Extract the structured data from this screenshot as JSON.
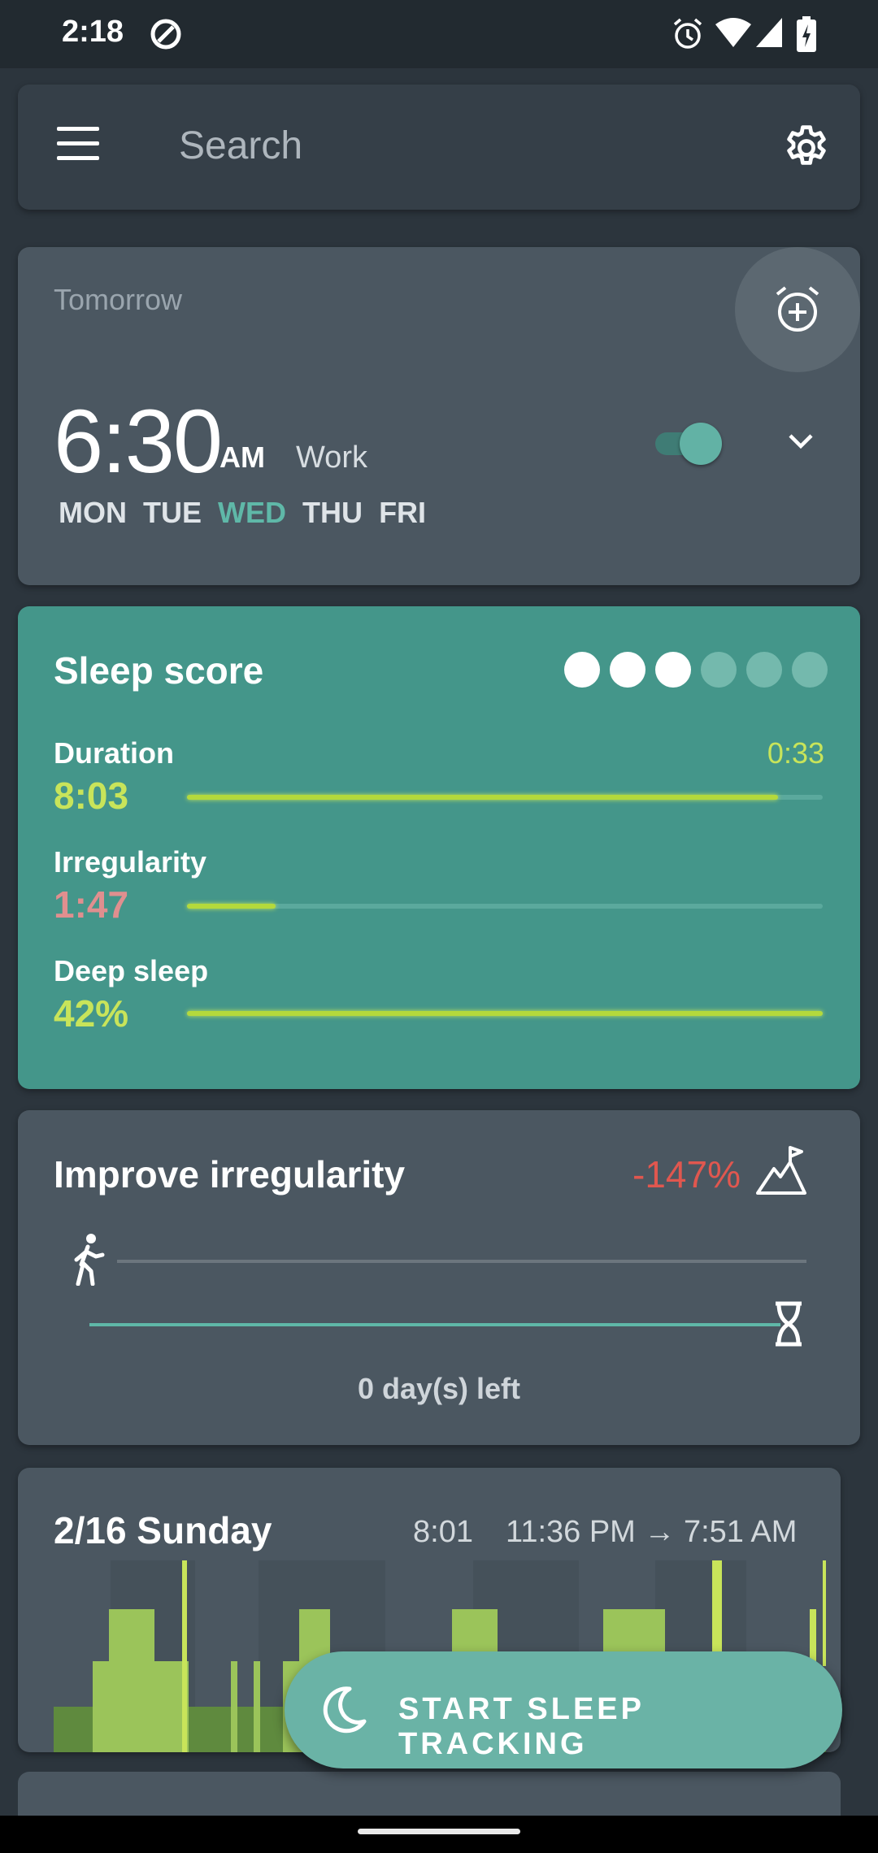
{
  "status_bar": {
    "time": "2:18",
    "icons": [
      "data-saver-icon",
      "alarm-icon",
      "wifi-icon",
      "signal-icon",
      "battery-charging-icon"
    ]
  },
  "search": {
    "placeholder": "Search",
    "menu_icon": "hamburger-menu-icon",
    "settings_icon": "gear-icon"
  },
  "alarm": {
    "label": "Tomorrow",
    "time": "6:30",
    "ampm": "AM",
    "name": "Work",
    "days": [
      {
        "label": "MON",
        "active": false
      },
      {
        "label": "TUE",
        "active": false
      },
      {
        "label": "WED",
        "active": true
      },
      {
        "label": "THU",
        "active": false
      },
      {
        "label": "FRI",
        "active": false
      }
    ],
    "enabled": true,
    "add_icon": "alarm-add-icon",
    "expand_icon": "chevron-down-icon"
  },
  "sleep_score": {
    "title": "Sleep score",
    "dots_total": 6,
    "dots_filled": 3,
    "metrics": [
      {
        "label": "Duration",
        "value": "8:03",
        "value_color": "#c8e45a",
        "progress": 0.93
      },
      {
        "label": "Irregularity",
        "value": "1:47",
        "value_color": "#e08f8f",
        "progress": 0.14
      },
      {
        "label": "Deep sleep",
        "value": "42%",
        "value_color": "#c8e45a",
        "progress": 1.0
      }
    ],
    "delta": "0:33"
  },
  "improve": {
    "title": "Improve irregularity",
    "percent": "-147%",
    "days_left": "0 day(s) left",
    "goal_icon": "mountain-flag-icon",
    "walk_icon": "walking-person-icon",
    "timer_icon": "hourglass-icon"
  },
  "history": {
    "date": "2/16 Sunday",
    "duration": "8:01",
    "range": "11:36 PM → 7:51 AM"
  },
  "fab": {
    "label": "START SLEEP TRACKING",
    "icon": "moon-icon"
  },
  "colors": {
    "accent": "#5fb8a8",
    "score_bg": "#44968a",
    "good": "#c8e45a",
    "bad": "#e0574f"
  }
}
